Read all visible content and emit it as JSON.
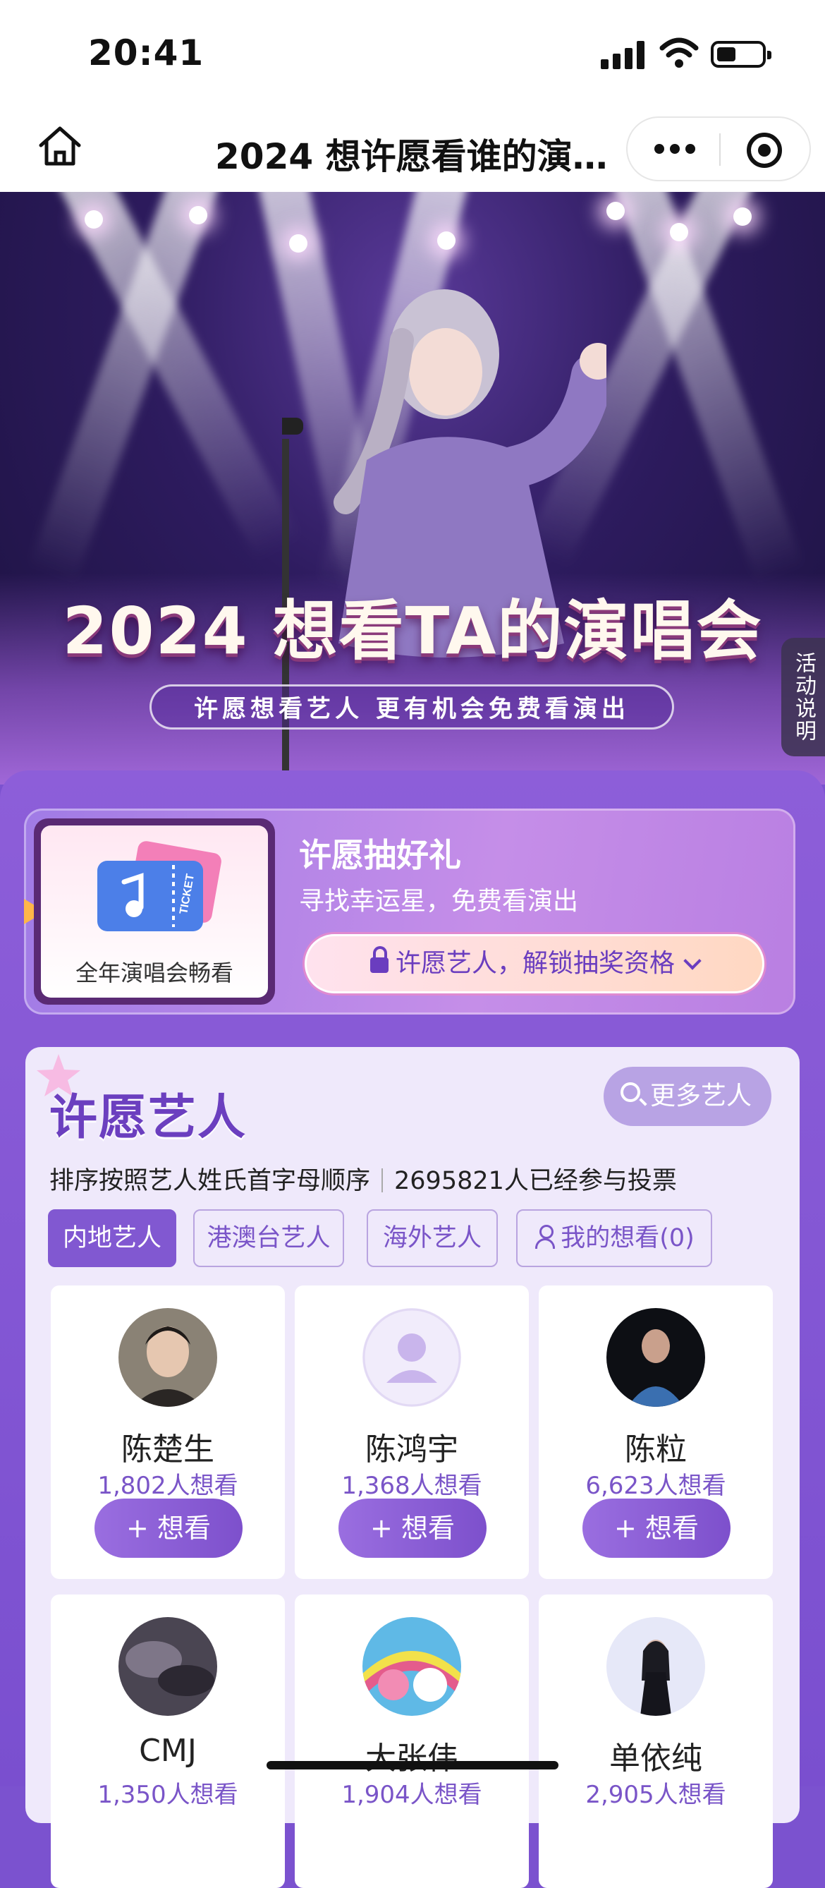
{
  "status_bar": {
    "time": "20:41"
  },
  "nav": {
    "title": "2024 想许愿看谁的演唱会"
  },
  "hero": {
    "title": "2024 想看TA的演唱会",
    "subtitle": "许愿想看艺人  更有机会免费看演出",
    "rules_tab": "活动说明"
  },
  "lottery": {
    "card_label": "全年演唱会畅看",
    "ticket_text": "TICKET",
    "title": "许愿抽好礼",
    "subtitle": "寻找幸运星，免费看演出",
    "unlock_label": "许愿艺人，解锁抽奖资格"
  },
  "wish": {
    "title": "许愿艺人",
    "more_label": "更多艺人",
    "sort_note": "排序按照艺人姓氏首字母顺序",
    "participants": "2695821人已经参与投票",
    "tabs": [
      {
        "label": "内地艺人",
        "active": true
      },
      {
        "label": "港澳台艺人",
        "active": false
      },
      {
        "label": "海外艺人",
        "active": false
      },
      {
        "label": "我的想看(0)",
        "active": false
      }
    ],
    "want_label": "+ 想看",
    "artists": [
      {
        "name": "陈楚生",
        "count": "1,802人想看"
      },
      {
        "name": "陈鸿宇",
        "count": "1,368人想看"
      },
      {
        "name": "陈粒",
        "count": "6,623人想看"
      },
      {
        "name": "CMJ",
        "count": "1,350人想看"
      },
      {
        "name": "大张伟",
        "count": "1,904人想看"
      },
      {
        "name": "单依纯",
        "count": "2,905人想看"
      }
    ]
  }
}
